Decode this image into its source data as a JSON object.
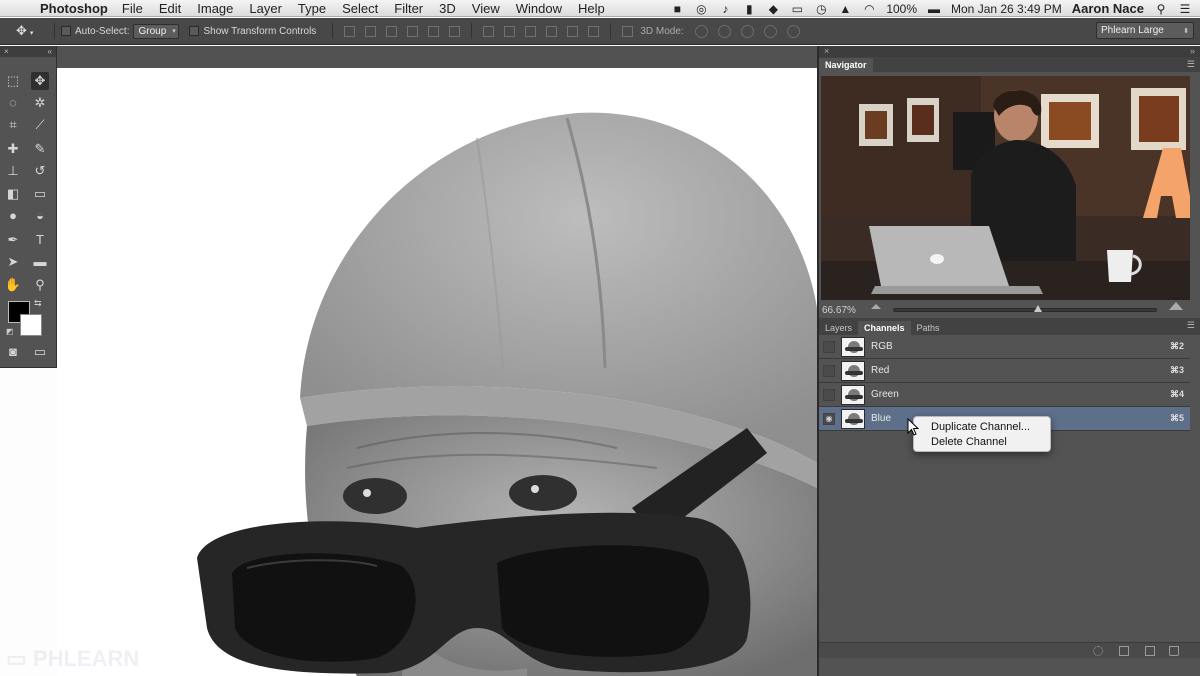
{
  "menubar": {
    "app_name": "Photoshop",
    "items": [
      "File",
      "Edit",
      "Image",
      "Layer",
      "Type",
      "Select",
      "Filter",
      "3D",
      "View",
      "Window",
      "Help"
    ],
    "status_icons": [
      "camera-icon",
      "creative-cloud-icon",
      "bell-icon",
      "evernote-icon",
      "dropbox-icon",
      "display-icon",
      "clock-icon",
      "airplay-icon",
      "wifi-icon",
      "battery-icon"
    ],
    "battery": "100%",
    "datetime": "Mon Jan 26  3:49 PM",
    "user": "Aaron Nace"
  },
  "options_bar": {
    "auto_select_label": "Auto-Select:",
    "auto_select_value": "Group",
    "show_transform_label": "Show Transform Controls",
    "mode_3d_label": "3D Mode:",
    "workspace": "Phlearn Large"
  },
  "navigator": {
    "title": "Navigator",
    "zoom": "66.67%",
    "zoom_fraction": 0.55
  },
  "channels_panel": {
    "tabs": [
      "Layers",
      "Channels",
      "Paths"
    ],
    "active_tab": "Channels",
    "channels": [
      {
        "name": "RGB",
        "shortcut": "⌘2",
        "visible": false,
        "selected": false
      },
      {
        "name": "Red",
        "shortcut": "⌘3",
        "visible": false,
        "selected": false
      },
      {
        "name": "Green",
        "shortcut": "⌘4",
        "visible": false,
        "selected": false
      },
      {
        "name": "Blue",
        "shortcut": "⌘5",
        "visible": true,
        "selected": true
      }
    ]
  },
  "context_menu": {
    "items": [
      "Duplicate Channel...",
      "Delete Channel"
    ]
  },
  "colors": {
    "foreground": "#000000",
    "background": "#ffffff",
    "panel_bg": "#535353",
    "selection": "#5e6f8a"
  }
}
